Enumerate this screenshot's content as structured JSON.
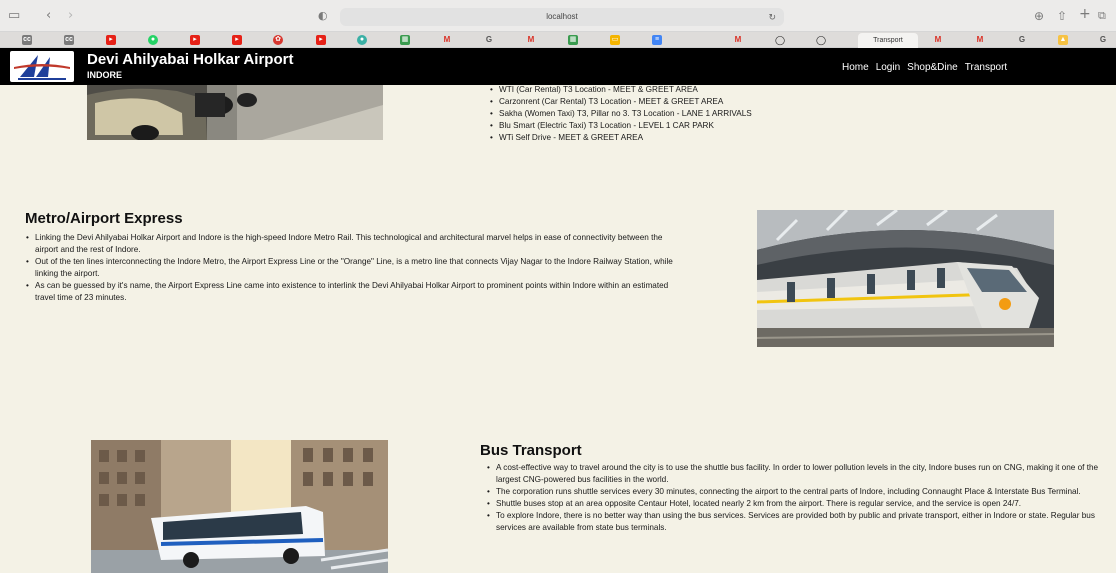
{
  "browser": {
    "address": "localhost",
    "active_tab": "Transport"
  },
  "site": {
    "title": "Devi Ahilyabai Holkar Airport",
    "subtitle": "INDORE",
    "nav": [
      "Home",
      "Login",
      "Shop&Dine",
      "Transport"
    ]
  },
  "taxi": {
    "items": [
      "WTI (Car Rental) T3 Location - MEET & GREET AREA",
      "Carzonrent (Car Rental) T3 Location - MEET & GREET AREA",
      "Sakha (Women Taxi) T3, Pillar no 3. T3 Location - LANE 1 ARRIVALS",
      "Blu Smart (Electric Taxi) T3 Location - LEVEL 1 CAR PARK",
      "WTi Self Drive - MEET & GREET AREA"
    ]
  },
  "metro": {
    "heading": "Metro/Airport Express",
    "items": [
      "Linking the Devi Ahilyabai Holkar Airport and Indore is the high-speed Indore Metro Rail. This technological and architectural marvel helps in ease of connectivity between the airport and the rest of Indore.",
      "Out of the ten lines interconnecting the Indore Metro, the Airport Express Line or the \"Orange\" Line, is a metro line that connects Vijay Nagar to the Indore Railway Station, while linking the airport.",
      "As can be guessed by it's name, the Airport Express Line came into existence to interlink the Devi Ahilyabai Holkar Airport to prominent points within Indore within an estimated travel time of 23 minutes."
    ]
  },
  "bus": {
    "heading": "Bus Transport",
    "items": [
      "A cost-effective way to travel around the city is to use the shuttle bus facility. In order to lower pollution levels in the city, Indore buses run on CNG, making it one of the largest CNG-powered bus facilities in the world.",
      "The corporation runs shuttle services every 30 minutes, connecting the airport to the central parts of Indore, including Connaught Place & Interstate Bus Terminal.",
      "Shuttle buses stop at an area opposite Centaur Hotel, located nearly 2 km from the airport. There is regular service, and the service is open 24/7.",
      "To explore Indore, there is no better way than using the bus services. Services are provided both by public and private transport, either in Indore or state. Regular bus services are available from state bus terminals."
    ]
  }
}
